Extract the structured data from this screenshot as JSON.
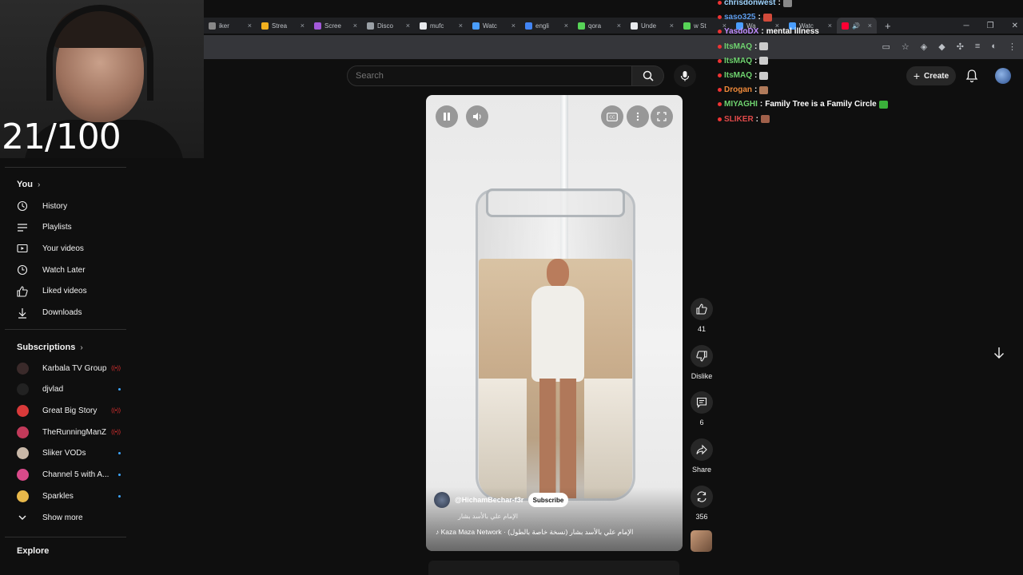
{
  "stream": {
    "counter": "21/100"
  },
  "browser": {
    "tabs": [
      {
        "label": "iker",
        "color": "#888888"
      },
      {
        "label": "Strea",
        "color": "#f2b01e"
      },
      {
        "label": "Scree",
        "color": "#a259d9"
      },
      {
        "label": "Disco",
        "color": "#9aa0a6"
      },
      {
        "label": "mufc",
        "color": "#e8eaed"
      },
      {
        "label": "Watc",
        "color": "#4a9eff"
      },
      {
        "label": "engli",
        "color": "#4285f4"
      },
      {
        "label": "qora",
        "color": "#57d357"
      },
      {
        "label": "Unde",
        "color": "#e8eaed"
      },
      {
        "label": "w St",
        "color": "#57d357"
      },
      {
        "label": "Wa",
        "color": "#4a9eff"
      },
      {
        "label": "Watc",
        "color": "#4a9eff"
      }
    ]
  },
  "header": {
    "search_placeholder": "Search",
    "create_label": "Create"
  },
  "sidebar": {
    "you_label": "You",
    "you_items": [
      {
        "label": "History",
        "icon": "history-icon"
      },
      {
        "label": "Playlists",
        "icon": "playlists-icon"
      },
      {
        "label": "Your videos",
        "icon": "your-videos-icon"
      },
      {
        "label": "Watch Later",
        "icon": "watch-later-icon"
      },
      {
        "label": "Liked videos",
        "icon": "liked-videos-icon"
      },
      {
        "label": "Downloads",
        "icon": "downloads-icon"
      }
    ],
    "subscriptions_label": "Subscriptions",
    "subscriptions": [
      {
        "name": "Karbala TV Group",
        "status": "live",
        "color": "#3a2a2a"
      },
      {
        "name": "djvlad",
        "status": "new",
        "color": "#222222"
      },
      {
        "name": "Great Big Story",
        "status": "live",
        "color": "#d93a3a"
      },
      {
        "name": "TheRunningManZ",
        "status": "live",
        "color": "#c23a5a"
      },
      {
        "name": "Sliker VODs",
        "status": "new",
        "color": "#c9b8a8"
      },
      {
        "name": "Channel 5 with A...",
        "status": "new",
        "color": "#d94a8a"
      },
      {
        "name": "Sparkles",
        "status": "new",
        "color": "#e8b84a"
      }
    ],
    "show_more_label": "Show more",
    "explore_label": "Explore"
  },
  "chat": [
    {
      "user": "chrisdonwest",
      "text": "",
      "color": "#9fd4ff",
      "emote": "#888888"
    },
    {
      "user": "saso325",
      "text": "",
      "color": "#5d9cec",
      "emote": "#d14a3a"
    },
    {
      "user": "YasdoDX",
      "text": "mental illness",
      "color": "#c08cff",
      "emote": ""
    },
    {
      "user": "ItsMAQ",
      "text": "",
      "color": "#6fd36f",
      "emote": "#cccccc"
    },
    {
      "user": "ItsMAQ",
      "text": "",
      "color": "#6fd36f",
      "emote": "#cccccc"
    },
    {
      "user": "ItsMAQ",
      "text": "",
      "color": "#6fd36f",
      "emote": "#cccccc"
    },
    {
      "user": "Drogan",
      "text": "",
      "color": "#f08a3a",
      "emote": "#b07a5a"
    },
    {
      "user": "MIYAGHI",
      "text": "Family Tree is a Family Circle",
      "color": "#6fd36f",
      "emote": "#3ab03a"
    },
    {
      "user": "SLIKER",
      "text": "",
      "color": "#e04a4a",
      "emote": "#a0604a"
    }
  ],
  "video": {
    "channel": "@HichamBechar-f3r",
    "subscribe_label": "Subscribe",
    "title": "الإمام علي بالأسد بشار",
    "music": "Kaza Maza Network · (الإمام علي بالأسد بشار (نسخة خاصة بالطول"
  },
  "actions": {
    "likes": "41",
    "dislike_label": "Dislike",
    "comments": "6",
    "share_label": "Share",
    "remixes": "356"
  }
}
